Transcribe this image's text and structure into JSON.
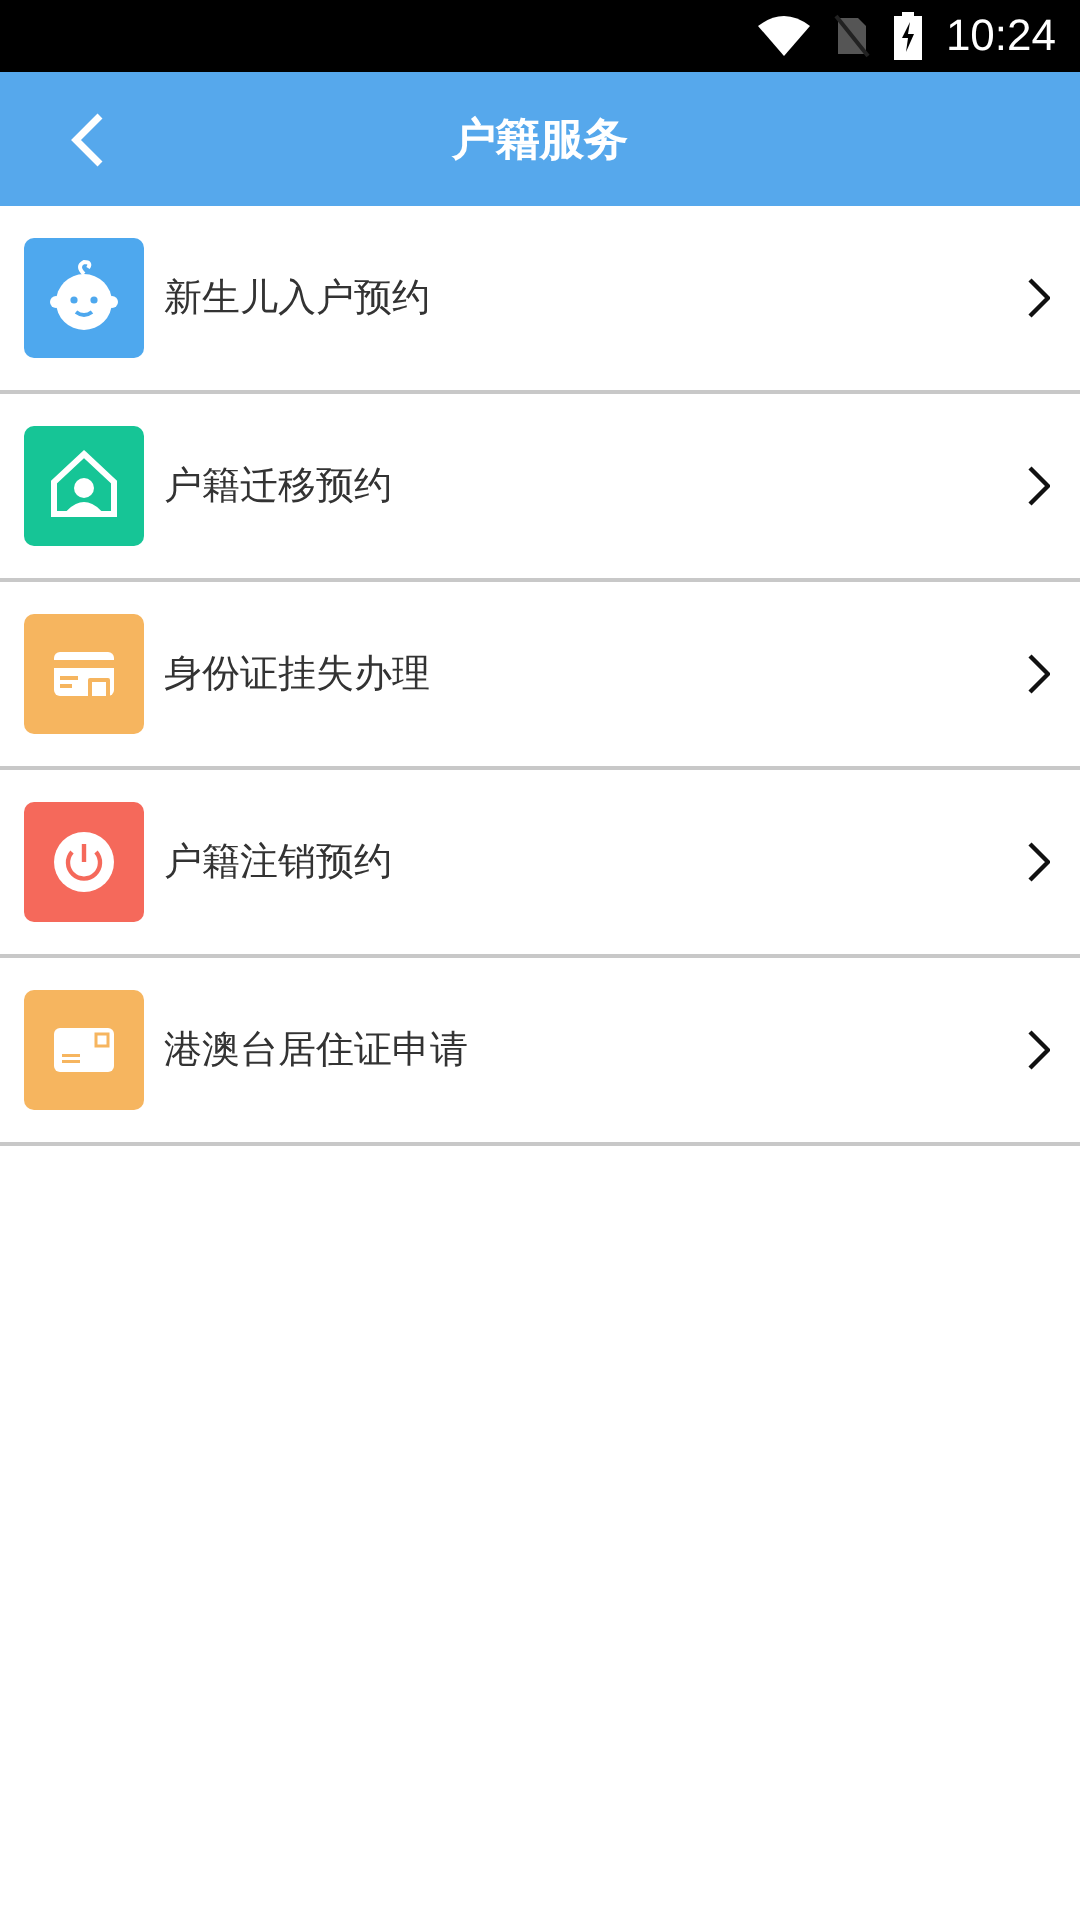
{
  "status_bar": {
    "time": "10:24"
  },
  "app_bar": {
    "title": "户籍服务"
  },
  "items": [
    {
      "label": "新生儿入户预约",
      "kind": "baby",
      "color": "#4ea8ee"
    },
    {
      "label": "户籍迁移预约",
      "kind": "house",
      "color": "#16c596"
    },
    {
      "label": "身份证挂失办理",
      "kind": "card-lock",
      "color": "#f6b55f"
    },
    {
      "label": "户籍注销预约",
      "kind": "power",
      "color": "#f5695b"
    },
    {
      "label": "港澳台居住证申请",
      "kind": "permit",
      "color": "#f6b55f"
    }
  ]
}
